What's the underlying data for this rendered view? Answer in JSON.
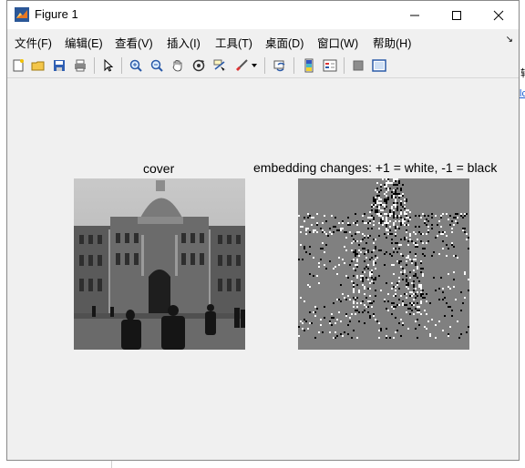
{
  "window": {
    "title": "Figure 1"
  },
  "menu": [
    "文件(F)",
    "编辑(E)",
    "查看(V)",
    "插入(I)",
    "工具(T)",
    "桌面(D)",
    "窗口(W)",
    "帮助(H)"
  ],
  "toolbar": [
    "new-figure-icon",
    "open-file-icon",
    "save-icon",
    "print-icon",
    "edit-plot-icon",
    "zoom-in-icon",
    "zoom-out-icon",
    "pan-icon",
    "rotate-3d-icon",
    "data-cursor-icon",
    "brush-icon",
    "brush-dropdown-icon",
    "link-plot-icon",
    "colorbar-icon",
    "legend-icon",
    "hide-plot-tools-icon",
    "show-plot-tools-icon"
  ],
  "axes": {
    "left_title": "cover",
    "right_title": "embedding changes: +1 = white, -1 = black"
  },
  "background_window": {
    "fragment_1": "转",
    "fragment_2": "lc"
  },
  "colors": {
    "window_bg": "#f0f0f0",
    "change_gray": "#808080"
  }
}
